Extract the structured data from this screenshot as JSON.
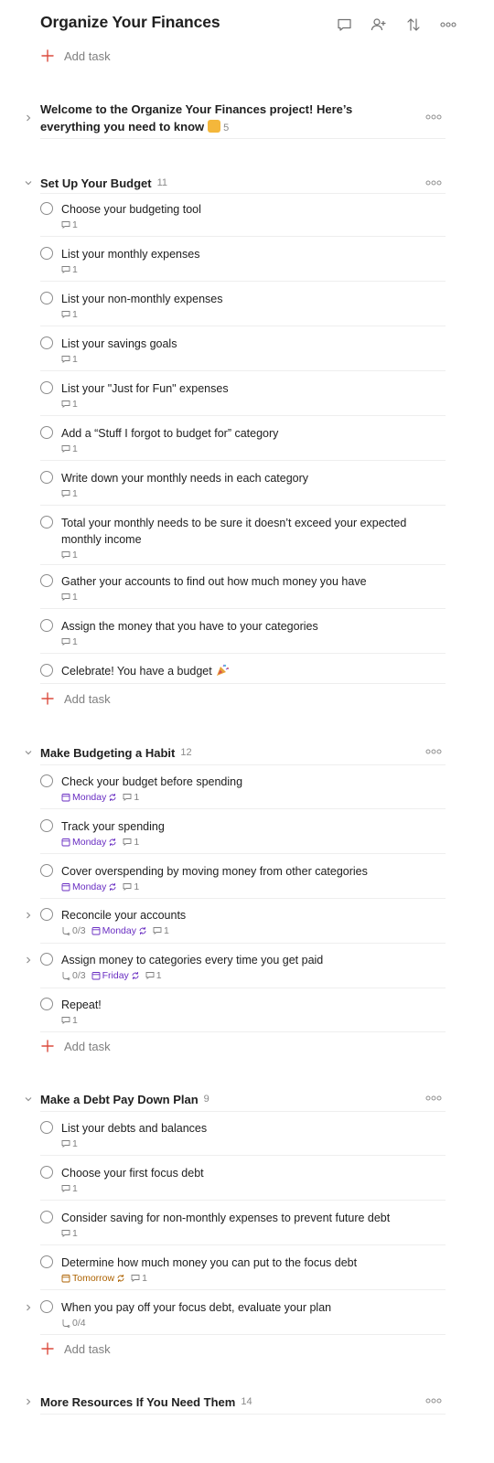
{
  "project": {
    "title": "Organize Your Finances",
    "add_task_label": "Add task",
    "header_icons": [
      "comment-icon",
      "add-person-icon",
      "sort-icon",
      "more-icon"
    ]
  },
  "welcome": {
    "text": "Welcome to the Organize Your Finances project! Here’s everything you need to know",
    "emoji": "pointing-down-icon",
    "count": "5"
  },
  "sections": [
    {
      "name": "Set Up Your Budget",
      "count": "11",
      "add_task_label": "Add task",
      "tasks": [
        {
          "text": "Choose your budgeting tool",
          "comments": "1"
        },
        {
          "text": "List your monthly expenses",
          "comments": "1"
        },
        {
          "text": "List your non-monthly expenses",
          "comments": "1"
        },
        {
          "text": "List your savings goals",
          "comments": "1"
        },
        {
          "text": "List your \"Just for Fun\" expenses",
          "comments": "1"
        },
        {
          "text": "Add a “Stuff I forgot to budget for” category",
          "comments": "1"
        },
        {
          "text": "Write down your monthly needs in each category",
          "comments": "1"
        },
        {
          "text": "Total your monthly needs to be sure it doesn’t exceed your expected monthly income",
          "comments": "1"
        },
        {
          "text": "Gather your accounts to find out how much money you have",
          "comments": "1"
        },
        {
          "text": "Assign the money that you have to your categories",
          "comments": "1"
        },
        {
          "text": "Celebrate! You have a budget",
          "emoji": "party-popper-icon"
        }
      ]
    },
    {
      "name": "Make Budgeting a Habit",
      "count": "12",
      "add_task_label": "Add task",
      "tasks": [
        {
          "text": "Check your budget before spending",
          "date": "Monday",
          "comments": "1"
        },
        {
          "text": "Track your spending",
          "date": "Monday",
          "comments": "1"
        },
        {
          "text": "Cover overspending by moving money from other categories",
          "date": "Monday",
          "comments": "1"
        },
        {
          "text": "Reconcile your accounts",
          "subtasks": "0/3",
          "date": "Monday",
          "comments": "1"
        },
        {
          "text": "Assign money to categories every time you get paid",
          "subtasks": "0/3",
          "date": "Friday",
          "comments": "1"
        },
        {
          "text": "Repeat!",
          "comments": "1"
        }
      ]
    },
    {
      "name": "Make a Debt Pay Down Plan",
      "count": "9",
      "add_task_label": "Add task",
      "tasks": [
        {
          "text": "List your debts and balances",
          "comments": "1"
        },
        {
          "text": "Choose your first focus debt",
          "comments": "1"
        },
        {
          "text": "Consider saving for non-monthly expenses to prevent future debt",
          "comments": "1"
        },
        {
          "text": "Determine how much money you can put to the focus debt",
          "date": "Tomorrow",
          "comments": "1"
        },
        {
          "text": "When you pay off your focus debt, evaluate your plan",
          "subtasks": "0/4"
        }
      ]
    },
    {
      "name": "More Resources If You Need Them",
      "count": "14"
    }
  ],
  "colors": {
    "accent_red": "#dc4c3e",
    "date_purple": "#692ec2",
    "date_orange": "#ad6200",
    "muted": "#808080"
  }
}
